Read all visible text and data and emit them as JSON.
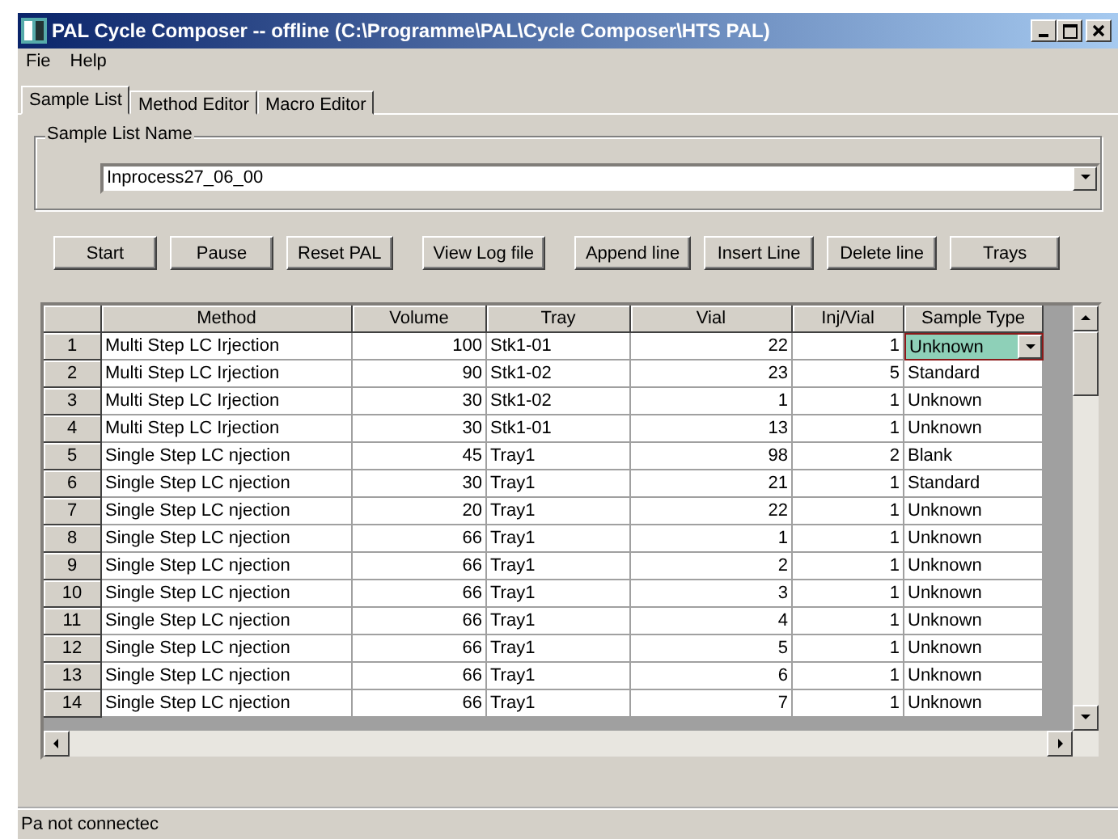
{
  "window": {
    "title": "PAL Cycle Composer -- offline  (C:\\Programme\\PAL\\Cycle Composer\\HTS PAL)"
  },
  "menu": [
    "Fie",
    "Help"
  ],
  "tabs": [
    {
      "label": "Sample List",
      "selected": true
    },
    {
      "label": "Method Editor",
      "selected": false
    },
    {
      "label": "Macro Editor",
      "selected": false
    }
  ],
  "sample_list_name": {
    "label": "Sample List Name",
    "value": "Inprocess27_06_00"
  },
  "buttons": [
    "Start",
    "Pause",
    "Reset PAL",
    "View Log file",
    "Append line",
    "Insert Line",
    "Delete line",
    "Trays"
  ],
  "table": {
    "columns": [
      "Method",
      "Volume",
      "Tray",
      "Vial",
      "Inj/Vial",
      "Sample Type"
    ],
    "rows": [
      {
        "number": "1",
        "method": "Multi Step LC Irjection",
        "volume": "100",
        "tray": "Stk1-01",
        "vial": "22",
        "inj_vial": "1",
        "sample_type": "Unknown",
        "selected": true
      },
      {
        "number": "2",
        "method": "Multi Step LC Irjection",
        "volume": "90",
        "tray": "Stk1-02",
        "vial": "23",
        "inj_vial": "5",
        "sample_type": "Standard",
        "selected": false
      },
      {
        "number": "3",
        "method": "Multi Step LC Irjection",
        "volume": "30",
        "tray": "Stk1-02",
        "vial": "1",
        "inj_vial": "1",
        "sample_type": "Unknown",
        "selected": false
      },
      {
        "number": "4",
        "method": "Multi Step LC Irjection",
        "volume": "30",
        "tray": "Stk1-01",
        "vial": "13",
        "inj_vial": "1",
        "sample_type": "Unknown",
        "selected": false
      },
      {
        "number": "5",
        "method": "Single Step LC njection",
        "volume": "45",
        "tray": "Tray1",
        "vial": "98",
        "inj_vial": "2",
        "sample_type": "Blank",
        "selected": false
      },
      {
        "number": "6",
        "method": "Single Step LC njection",
        "volume": "30",
        "tray": "Tray1",
        "vial": "21",
        "inj_vial": "1",
        "sample_type": "Standard",
        "selected": false
      },
      {
        "number": "7",
        "method": "Single Step LC njection",
        "volume": "20",
        "tray": "Tray1",
        "vial": "22",
        "inj_vial": "1",
        "sample_type": "Unknown",
        "selected": false
      },
      {
        "number": "8",
        "method": "Single Step LC njection",
        "volume": "66",
        "tray": "Tray1",
        "vial": "1",
        "inj_vial": "1",
        "sample_type": "Unknown",
        "selected": false
      },
      {
        "number": "9",
        "method": "Single Step LC njection",
        "volume": "66",
        "tray": "Tray1",
        "vial": "2",
        "inj_vial": "1",
        "sample_type": "Unknown",
        "selected": false
      },
      {
        "number": "10",
        "method": "Single Step LC njection",
        "volume": "66",
        "tray": "Tray1",
        "vial": "3",
        "inj_vial": "1",
        "sample_type": "Unknown",
        "selected": false
      },
      {
        "number": "11",
        "method": "Single Step LC njection",
        "volume": "66",
        "tray": "Tray1",
        "vial": "4",
        "inj_vial": "1",
        "sample_type": "Unknown",
        "selected": false
      },
      {
        "number": "12",
        "method": "Single Step LC njection",
        "volume": "66",
        "tray": "Tray1",
        "vial": "5",
        "inj_vial": "1",
        "sample_type": "Unknown",
        "selected": false
      },
      {
        "number": "13",
        "method": "Single Step LC njection",
        "volume": "66",
        "tray": "Tray1",
        "vial": "6",
        "inj_vial": "1",
        "sample_type": "Unknown",
        "selected": false
      },
      {
        "number": "14",
        "method": "Single Step LC njection",
        "volume": "66",
        "tray": "Tray1",
        "vial": "7",
        "inj_vial": "1",
        "sample_type": "Unknown",
        "selected": false
      }
    ]
  },
  "status_bar": "Pa not connectec"
}
